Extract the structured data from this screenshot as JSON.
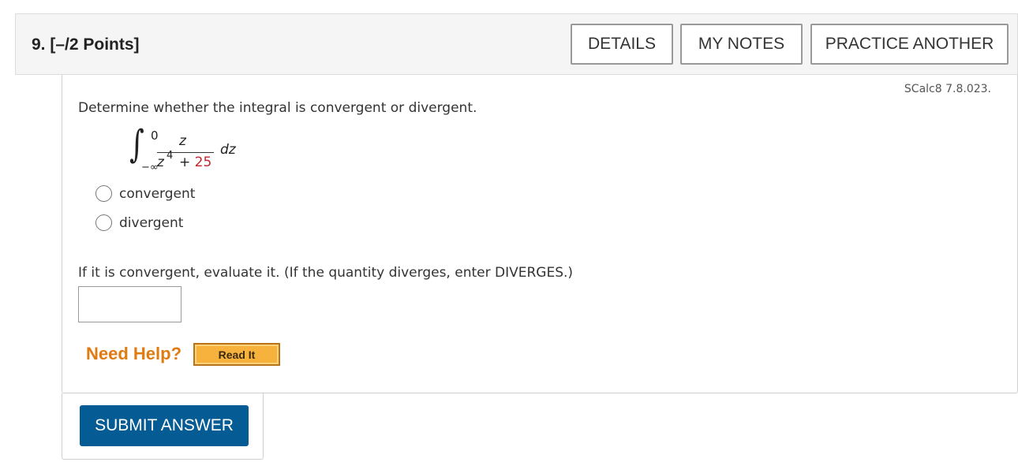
{
  "header": {
    "question_label": "9. [–/2 Points]",
    "details_label": "DETAILS",
    "my_notes_label": "MY NOTES",
    "practice_another_label": "PRACTICE ANOTHER"
  },
  "question": {
    "source": "SCalc8 7.8.023.",
    "prompt": "Determine whether the integral is convergent or divergent.",
    "integral": {
      "upper_limit": "0",
      "lower_limit": "−∞",
      "numerator": "z",
      "denominator_var": "z",
      "denominator_exp": "4",
      "denominator_plus": "+",
      "denominator_const": "25",
      "differential": "dz"
    },
    "options": [
      "convergent",
      "divergent"
    ],
    "prompt2": "If it is convergent, evaluate it. (If the quantity diverges, enter DIVERGES.)",
    "answer_value": ""
  },
  "help": {
    "need_help_label": "Need Help?",
    "read_it_label": "Read It"
  },
  "submit": {
    "label": "SUBMIT ANSWER"
  },
  "colors": {
    "submit_bg": "#055b94",
    "need_help": "#e07b12",
    "read_it_bg": "#f7b23e",
    "highlight_red": "#c0262c"
  }
}
